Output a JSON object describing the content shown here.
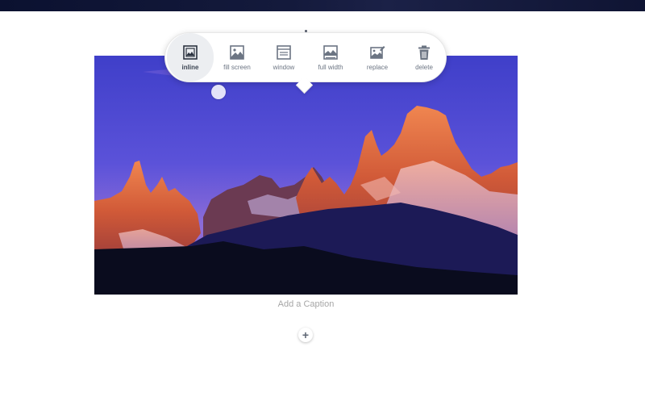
{
  "toolbar": {
    "items": [
      {
        "label": "inline",
        "icon": "inline-image-icon",
        "active": true
      },
      {
        "label": "fill screen",
        "icon": "fill-screen-icon",
        "active": false
      },
      {
        "label": "window",
        "icon": "window-icon",
        "active": false
      },
      {
        "label": "full width",
        "icon": "full-width-icon",
        "active": false
      },
      {
        "label": "replace",
        "icon": "replace-image-icon",
        "active": false
      },
      {
        "label": "delete",
        "icon": "trash-icon",
        "active": false
      }
    ]
  },
  "image": {
    "alt": "Mountain peaks at sunset"
  },
  "caption": {
    "placeholder": "Add a Caption"
  },
  "add_button": {
    "symbol": "+"
  },
  "colors": {
    "icon": "#6c7583",
    "active_icon": "#2b3340",
    "active_bg": "#eceef1"
  }
}
